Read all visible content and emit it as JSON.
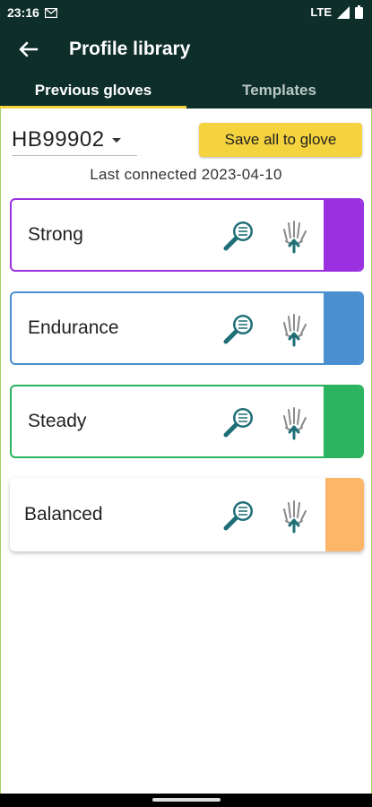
{
  "status_bar": {
    "time": "23:16",
    "network": "LTE"
  },
  "app_bar": {
    "title": "Profile library"
  },
  "tabs": [
    {
      "label": "Previous gloves",
      "active": true
    },
    {
      "label": "Templates",
      "active": false
    }
  ],
  "device_selector": {
    "value": "HB99902"
  },
  "save_button": {
    "label": "Save all to glove"
  },
  "last_connected": "Last connected 2023-04-10",
  "profiles": [
    {
      "name": "Strong",
      "color": "#9b30e0"
    },
    {
      "name": "Endurance",
      "color": "#4a8fd0"
    },
    {
      "name": "Steady",
      "color": "#2cb35f"
    },
    {
      "name": "Balanced",
      "color": "#fdb56a"
    }
  ],
  "colors": {
    "header": "#0e2e2a",
    "accent": "#f3d23e",
    "icon": "#1e6f77"
  },
  "icons": {
    "inspect": "magnifier-list-icon",
    "upload": "glove-upload-icon"
  }
}
